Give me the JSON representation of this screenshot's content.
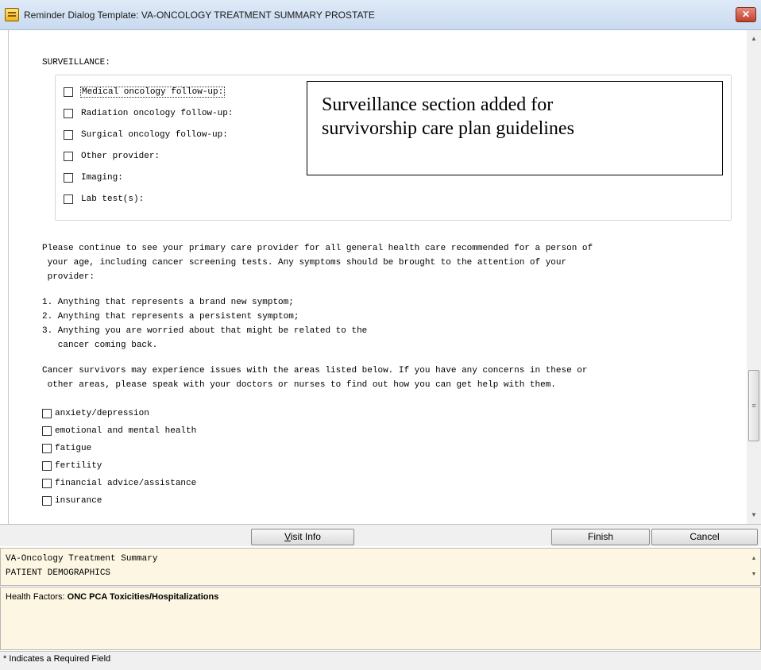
{
  "window": {
    "title": "Reminder Dialog Template: VA-ONCOLOGY TREATMENT SUMMARY PROSTATE",
    "close_glyph": "✕"
  },
  "surveillance": {
    "title": "SURVEILLANCE:",
    "items": [
      {
        "label": "Medical oncology follow-up:",
        "checked": false
      },
      {
        "label": "Radiation oncology follow-up:",
        "checked": false
      },
      {
        "label": "Surgical oncology follow-up:",
        "checked": false
      },
      {
        "label": "Other provider:",
        "checked": false
      },
      {
        "label": "Imaging:",
        "checked": false
      },
      {
        "label": "Lab test(s):",
        "checked": false
      }
    ]
  },
  "callout": {
    "line1": "Surveillance section added for",
    "line2": "survivorship care plan guidelines"
  },
  "body_text": {
    "para1_line1": "Please continue to see your primary care provider for all general health care recommended for a person of",
    "para1_line2": " your age, including cancer screening tests. Any symptoms should be brought to the attention of your",
    "para1_line3": " provider:",
    "list_1": "1. Anything that represents a brand new symptom;",
    "list_2": "2. Anything that represents a persistent symptom;",
    "list_3a": "3. Anything you are worried about that might be related to the",
    "list_3b": "   cancer coming back.",
    "para2_line1": "Cancer survivors may experience issues with the areas listed below. If you have any concerns in these or",
    "para2_line2": " other areas, please speak with your doctors or nurses to find out how you can get help with them."
  },
  "concerns": [
    {
      "label": "anxiety/depression",
      "checked": false
    },
    {
      "label": "emotional and mental health",
      "checked": false
    },
    {
      "label": "fatigue",
      "checked": false
    },
    {
      "label": "fertility",
      "checked": false
    },
    {
      "label": "financial advice/assistance",
      "checked": false
    },
    {
      "label": "insurance",
      "checked": false
    }
  ],
  "buttons": {
    "visit_info_underlined": "V",
    "visit_info_rest": "isit Info",
    "finish": "Finish",
    "cancel": "Cancel"
  },
  "info_panel": {
    "line1": "VA-Oncology Treatment Summary",
    "line2": "PATIENT DEMOGRAPHICS"
  },
  "health_factors": {
    "label": "Health Factors: ",
    "value": "ONC PCA Toxicities/Hospitalizations"
  },
  "status": {
    "text": "* Indicates a Required Field"
  },
  "icons": {
    "up": "▲",
    "down": "▼",
    "grip": "≡"
  }
}
